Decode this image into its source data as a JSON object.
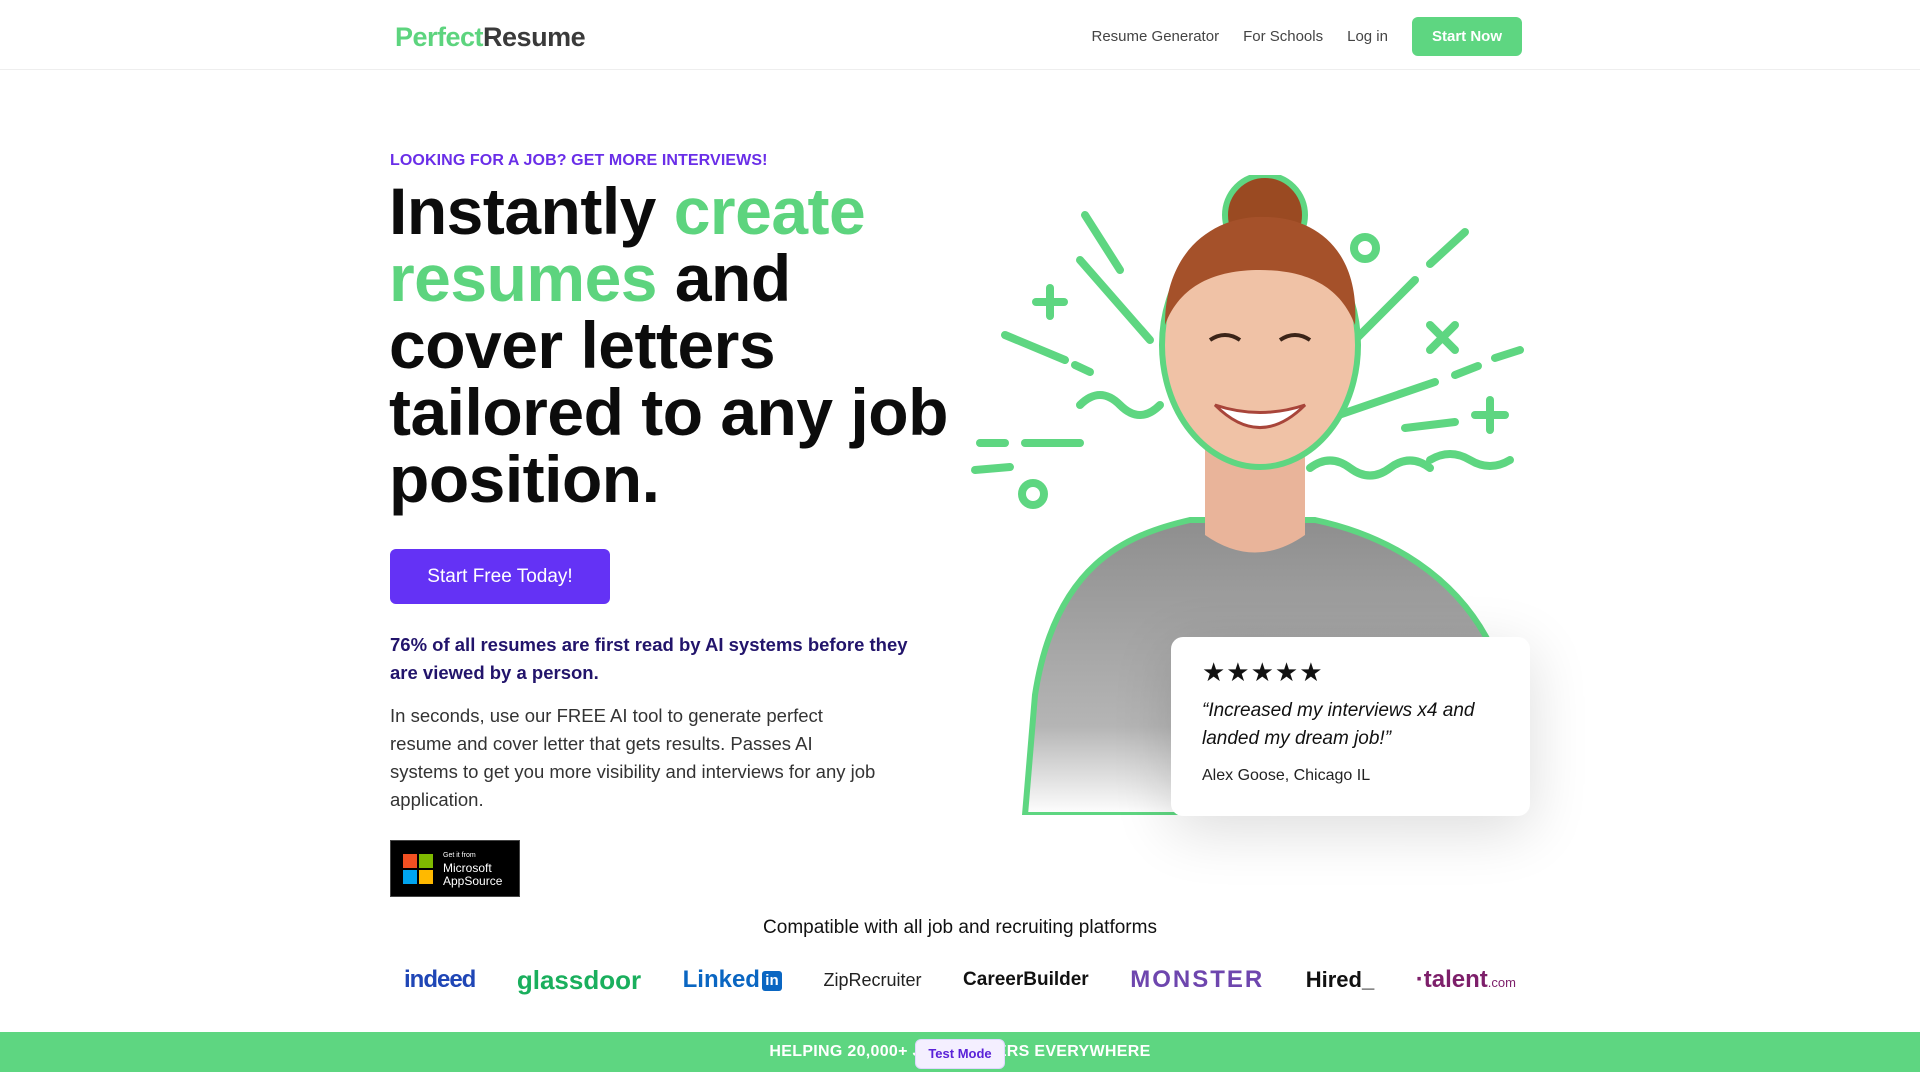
{
  "header": {
    "logo_part1": "Perfect",
    "logo_part2": "Resume",
    "nav": {
      "resume_generator": "Resume Generator",
      "for_schools": "For Schools",
      "login": "Log in",
      "start_now": "Start Now"
    }
  },
  "hero": {
    "eyebrow": "LOOKING FOR A JOB? GET MORE INTERVIEWS!",
    "headline_1": "Instantly ",
    "headline_2": "create resumes",
    "headline_3": " and cover letters tailored to any job position.",
    "cta": "Start Free Today!",
    "stat": "76% of all resumes are first read by AI systems before they are viewed by a person.",
    "description": "In seconds, use our FREE AI tool to generate perfect resume and cover letter that gets results. Passes AI systems to get you more visibility and interviews for any job application.",
    "badge_small": "Get it from",
    "badge_line1": "Microsoft",
    "badge_line2": "AppSource"
  },
  "review": {
    "stars": "★★★★★",
    "quote": "“Increased my interviews x4 and landed my dream job!”",
    "author": "Alex Goose, Chicago IL"
  },
  "platforms": {
    "heading": "Compatible with all job and recruiting platforms",
    "items": [
      "indeed",
      "glassdoor",
      "Linked",
      "ZipRecruiter",
      "CareerBuilder",
      "MONSTER",
      "Hired_",
      "·talent"
    ]
  },
  "banner": {
    "text": "HELPING 20,000+ JOB SEEKERS EVERYWHERE",
    "test_mode": "Test Mode"
  },
  "colors": {
    "brand_green": "#5ed681",
    "brand_purple": "#6432f5",
    "eyebrow_purple": "#6a2ee8",
    "stat_navy": "#22146b"
  }
}
